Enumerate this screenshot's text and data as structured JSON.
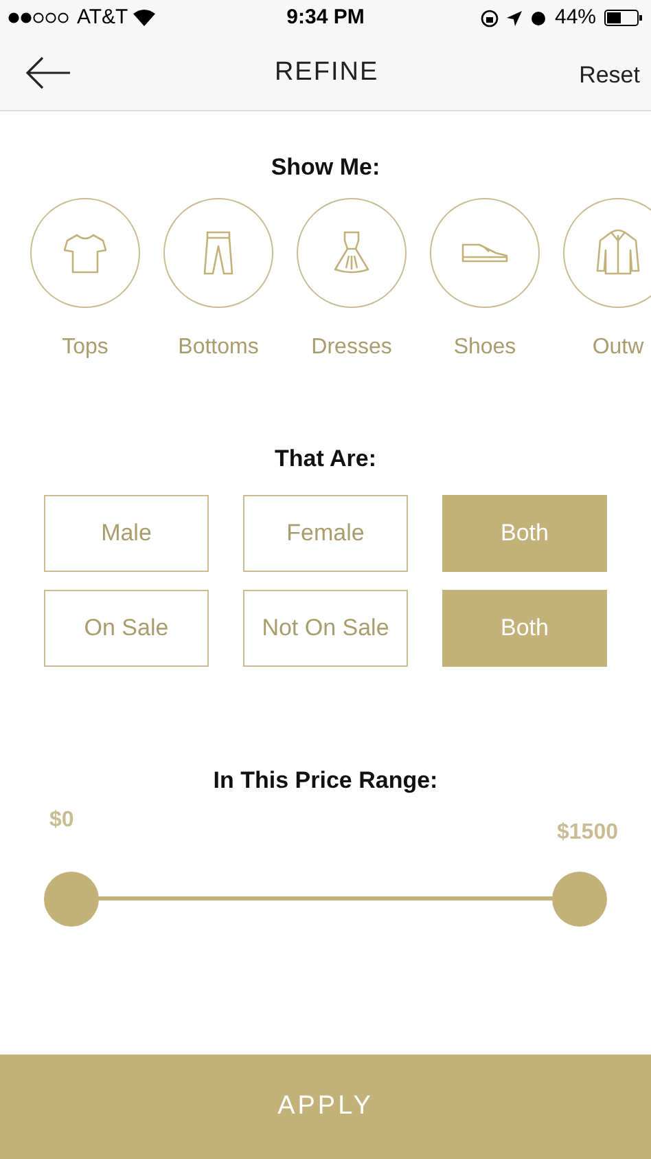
{
  "status_bar": {
    "carrier": "AT&T",
    "time": "9:34 PM",
    "battery": "44%"
  },
  "header": {
    "title": "REFINE",
    "action": "Reset"
  },
  "show_me": {
    "title": "Show Me:",
    "categories": [
      {
        "label": "Tops",
        "kind": "tshirt"
      },
      {
        "label": "Bottoms",
        "kind": "pants"
      },
      {
        "label": "Dresses",
        "kind": "dress"
      },
      {
        "label": "Shoes",
        "kind": "shoe"
      },
      {
        "label": "Outw",
        "kind": "jacket"
      }
    ]
  },
  "that_are": {
    "title": "That Are:",
    "groups": [
      [
        {
          "label": "Male",
          "selected": false
        },
        {
          "label": "Female",
          "selected": false
        },
        {
          "label": "Both",
          "selected": true
        }
      ],
      [
        {
          "label": "On Sale",
          "selected": false
        },
        {
          "label": "Not On Sale",
          "selected": false
        },
        {
          "label": "Both",
          "selected": true
        }
      ]
    ]
  },
  "price": {
    "title": "In This Price Range:",
    "min_label": "$0",
    "max_label": "$1500",
    "min_thumb": {
      "level": 0
    },
    "max_thumb": {
      "level": 1
    }
  },
  "apply_button": "APPLY"
}
